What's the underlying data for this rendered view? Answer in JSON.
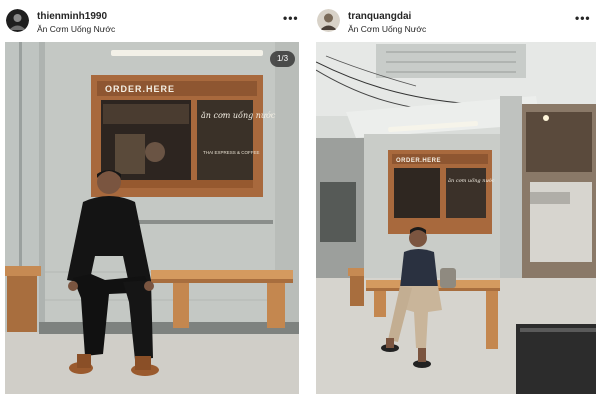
{
  "posts": [
    {
      "username": "thienminh1990",
      "location": "Ăn Cơm Uống Nước",
      "more_label": "•••",
      "carousel_counter": "1/3",
      "sign_text": "ORDER.HERE",
      "window_script": "ăn cơm uống nước",
      "window_note": "THAI EXPRESS & COFFEE",
      "avatar_color": "#1f1f1f"
    },
    {
      "username": "tranquangdai",
      "location": "Ăn Cơm Uống Nước",
      "more_label": "•••",
      "sign_text": "ORDER.HERE",
      "window_script": "ăn cơm uống nước",
      "avatar_color": "#7a6a58"
    }
  ],
  "colors": {
    "wall": "#c9ccc8",
    "wood": "#b8824f",
    "bench": "#d49a5f",
    "ground": "#cfcdc7"
  }
}
